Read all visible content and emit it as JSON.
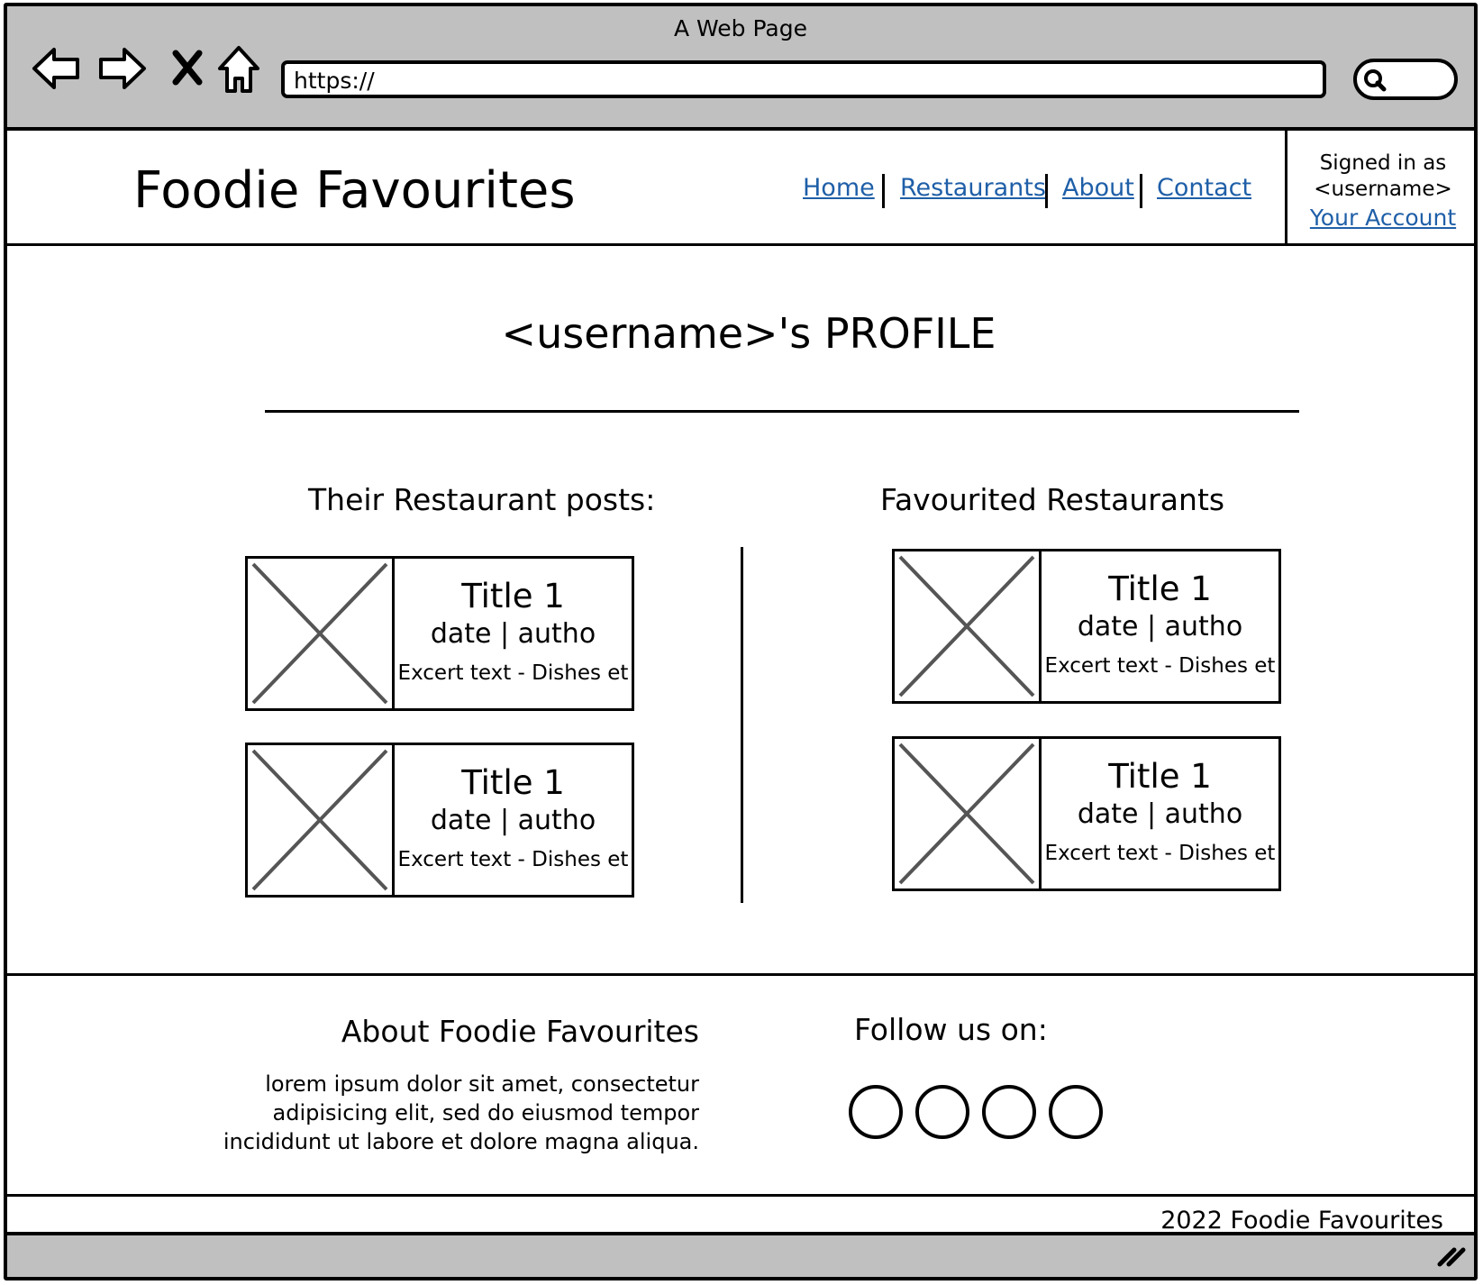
{
  "browser": {
    "window_title": "A Web Page",
    "url": "https://",
    "controls": [
      "back-arrow-icon",
      "forward-arrow-icon",
      "close-x-icon",
      "home-icon",
      "search-icon",
      "resize-grip-icon"
    ]
  },
  "header": {
    "site_title": "Foodie Favourites",
    "nav": [
      {
        "label": "Home"
      },
      {
        "label": "Restaurants"
      },
      {
        "label": "About"
      },
      {
        "label": "Contact"
      }
    ],
    "account": {
      "signed_in_line1": "Signed in as",
      "signed_in_line2": "<username>",
      "link_label": "Your Account"
    }
  },
  "main": {
    "profile_title": "<username>'s PROFILE",
    "posts": {
      "heading": "Their Restaurant posts:",
      "cards": [
        {
          "title": "Title 1",
          "meta": "date | autho",
          "excerpt": "Excert text - Dishes et"
        },
        {
          "title": "Title 1",
          "meta": "date | autho",
          "excerpt": "Excert text - Dishes et"
        }
      ]
    },
    "favourites": {
      "heading": "Favourited Restaurants",
      "cards": [
        {
          "title": "Title 1",
          "meta": "date | autho",
          "excerpt": "Excert text - Dishes et"
        },
        {
          "title": "Title 1",
          "meta": "date | autho",
          "excerpt": "Excert text - Dishes et"
        }
      ]
    }
  },
  "footer": {
    "about_heading": "About Foodie Favourites",
    "about_lines": [
      "lorem ipsum dolor sit amet, consectetur",
      "adipisicing elit, sed do eiusmod tempor",
      "incididunt ut labore et dolore magna aliqua."
    ],
    "follow_heading": "Follow us on:",
    "social_icons": [
      "social-icon-1",
      "social-icon-2",
      "social-icon-3",
      "social-icon-4"
    ],
    "copyright": "2022 Foodie Favourites"
  },
  "colors": {
    "chrome_gray": "#c0c0c0",
    "link_blue": "#1f5fa8",
    "placeholder_x": "#555555"
  }
}
